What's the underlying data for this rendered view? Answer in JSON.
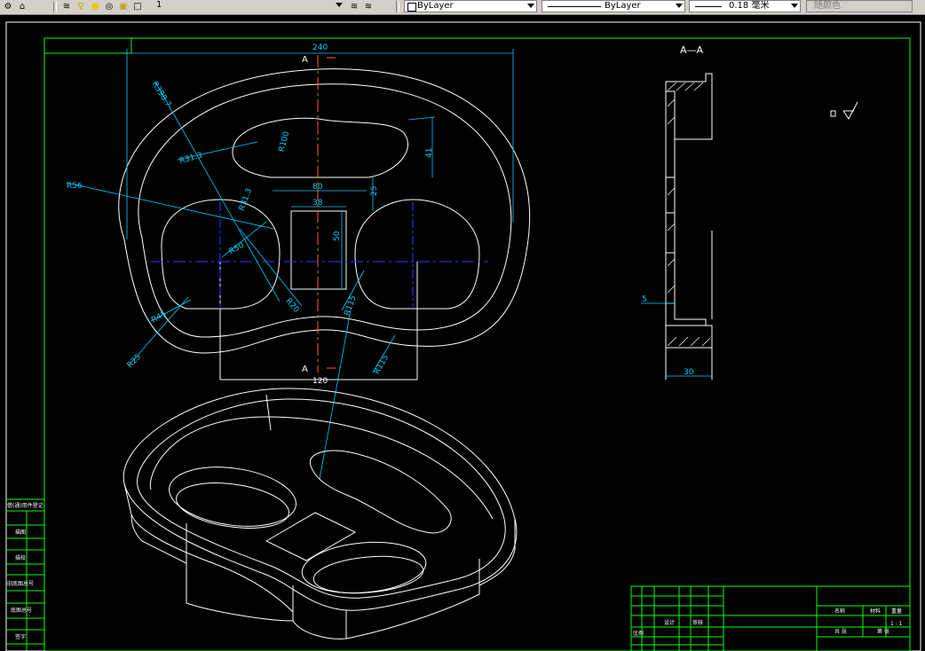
{
  "toolbar": {
    "layer_name": "1",
    "color": "ByLayer",
    "linetype": "ByLayer",
    "lineweight": "0.18 毫米",
    "plotstyle": "随颜色"
  },
  "drawing": {
    "section_label": "A—A",
    "cut_label_top": "A",
    "cut_label_bottom": "A",
    "dims": {
      "width_240": "240",
      "width_120": "120",
      "width_80": "80",
      "width_38": "38",
      "height_50": "50",
      "height_41": "41",
      "height_25": "25",
      "r398": "R398.7",
      "r100": "R100",
      "r31": "R31.3",
      "r31b": "R31.3",
      "r50": "R50",
      "r56": "R56",
      "r25": "R25",
      "r45": "R45",
      "r20": "R20",
      "r25b": "R25",
      "r115": "R115",
      "r115b": "R115",
      "r5": "5",
      "w30": "30"
    },
    "title_block": {
      "name_cell": "名称",
      "scale_cell": "1 : 1",
      "design": "设计",
      "check": "审核",
      "sheet": "共 张",
      "page": "第 张",
      "material": "材料",
      "weight": "重量",
      "ratio": "比例"
    },
    "side_column": {
      "c1": "借(通)用件登记",
      "c2": "描图",
      "c3": "描校",
      "c4": "旧底图总号",
      "c5": "底图总号",
      "c6": "签字"
    }
  }
}
